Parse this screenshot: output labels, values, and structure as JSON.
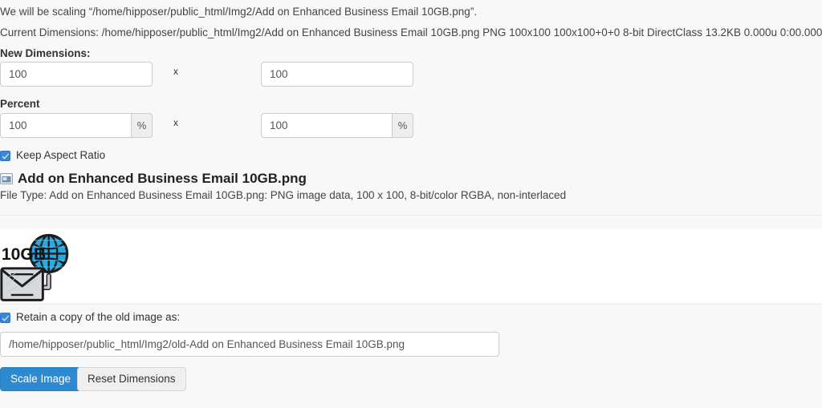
{
  "info": {
    "scaling_notice": "We will be scaling “/home/hipposer/public_html/Img2/Add on Enhanced Business Email 10GB.png”.",
    "current_dimensions": "Current Dimensions: /home/hipposer/public_html/Img2/Add on Enhanced Business Email 10GB.png PNG 100x100 100x100+0+0 8-bit DirectClass 13.2KB 0.000u 0:00.000"
  },
  "new_dimensions": {
    "label": "New Dimensions:",
    "width_value": "100",
    "height_value": "100",
    "separator": "x"
  },
  "percent": {
    "label": "Percent",
    "width_value": "100",
    "height_value": "100",
    "separator": "x",
    "addon_symbol": "%"
  },
  "keep_aspect_ratio": {
    "label": "Keep Aspect Ratio",
    "checked": true
  },
  "file": {
    "icon": "image-file-icon",
    "name": "Add on Enhanced Business Email 10GB.png",
    "type_line": "File Type: Add on Enhanced Business Email 10GB.png: PNG image data, 100 x 100, 8-bit/color RGBA, non-interlaced"
  },
  "preview": {
    "alt": "Add on Enhanced Business Email 10GB.png",
    "badge_text": "10GB",
    "globe_color": "#29a8e0",
    "envelope_color": "#d6d9de"
  },
  "retain_copy": {
    "label": "Retain a copy of the old image as:",
    "checked": true,
    "path_value": "/home/hipposer/public_html/Img2/old-Add on Enhanced Business Email 10GB.png"
  },
  "buttons": {
    "scale_image": "Scale Image",
    "reset_dimensions": "Reset Dimensions"
  },
  "colors": {
    "page_background": "#f8f8f8",
    "preview_background": "#ffffff",
    "primary_button": "#2e8ace",
    "checkbox_accent": "#3b88d8",
    "input_border": "#cccccc"
  }
}
